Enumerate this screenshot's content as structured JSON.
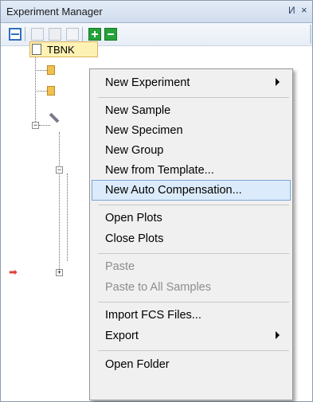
{
  "panel": {
    "title": "Experiment Manager",
    "pin_glyph": "И",
    "close_glyph": "×"
  },
  "toolbar": {
    "buttons": [
      {
        "name": "collapse-all-icon",
        "enabled": true
      },
      {
        "name": "copy-icon",
        "enabled": false
      },
      {
        "name": "paste-icon",
        "enabled": false
      },
      {
        "name": "document-icon",
        "enabled": false
      },
      {
        "name": "add-icon",
        "enabled": true,
        "color": "#25a23a"
      },
      {
        "name": "remove-icon",
        "enabled": true,
        "color": "#25a23a"
      }
    ]
  },
  "tree": {
    "root_label": "TBNK",
    "marker_glyph": "➡"
  },
  "context_menu": {
    "items": [
      {
        "label": "New Experiment",
        "submenu": true,
        "enabled": true
      },
      {
        "label": "New Sample",
        "enabled": true
      },
      {
        "label": "New Specimen",
        "enabled": true
      },
      {
        "label": "New Group",
        "enabled": true
      },
      {
        "label": "New from Template...",
        "enabled": true
      },
      {
        "label": "New Auto Compensation...",
        "enabled": true,
        "highlighted": true
      },
      {
        "label": "Open Plots",
        "enabled": true
      },
      {
        "label": "Close Plots",
        "enabled": true
      },
      {
        "label": "Paste",
        "enabled": false
      },
      {
        "label": "Paste to All Samples",
        "enabled": false
      },
      {
        "label": "Import FCS Files...",
        "enabled": true
      },
      {
        "label": "Export",
        "submenu": true,
        "enabled": true
      },
      {
        "label": "Open Folder",
        "enabled": true
      }
    ]
  },
  "colors": {
    "highlight": "#dcebfb",
    "highlight_border": "#7aa6d8",
    "disabled_text": "#8d8d8d",
    "marker": "#e0403a"
  }
}
